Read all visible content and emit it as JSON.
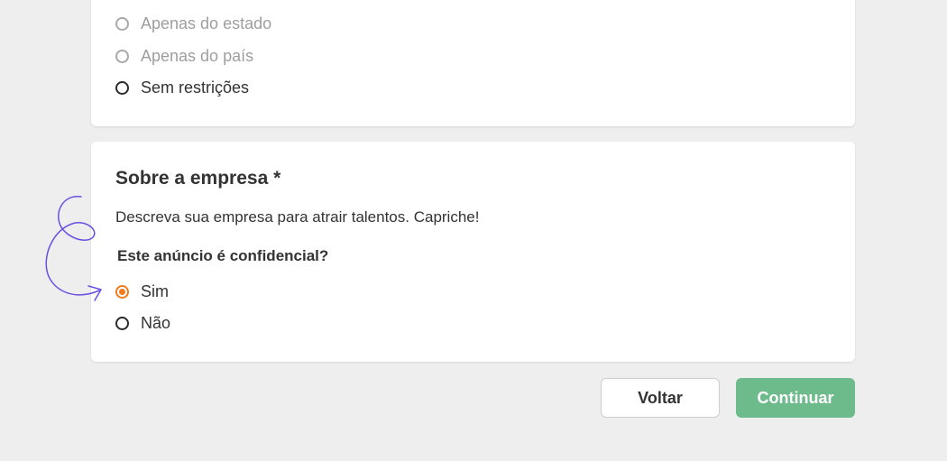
{
  "location_options": [
    {
      "label": "Apenas do estado",
      "state": "disabled"
    },
    {
      "label": "Apenas do país",
      "state": "disabled"
    },
    {
      "label": "Sem restrições",
      "state": "unchecked"
    }
  ],
  "company": {
    "title": "Sobre a empresa *",
    "description": "Descreva sua empresa para atrair talentos. Capriche!",
    "question": "Este anúncio é confidencial?",
    "options": [
      {
        "label": "Sim",
        "state": "checked"
      },
      {
        "label": "Não",
        "state": "unchecked"
      }
    ]
  },
  "buttons": {
    "back_label": "Voltar",
    "continue_label": "Continuar"
  },
  "colors": {
    "accent": "#f07b1f",
    "continue_bg": "#6dbb8a",
    "annotation": "#6a4fe0"
  }
}
